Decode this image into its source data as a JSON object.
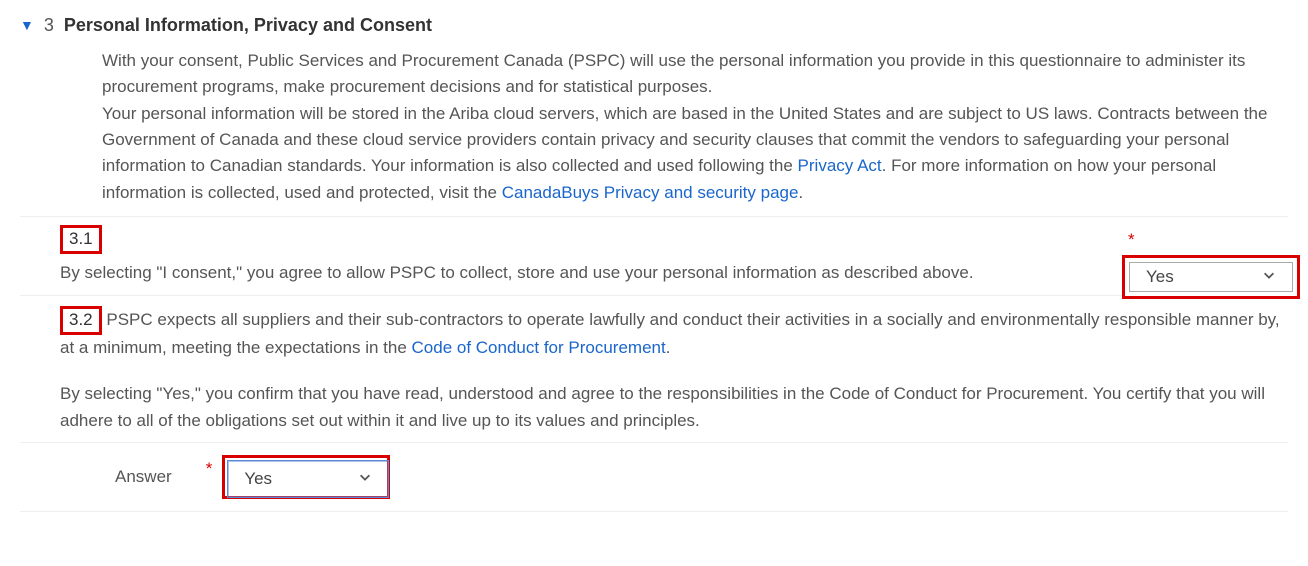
{
  "section": {
    "number": "3",
    "title": "Personal Information, Privacy and Consent",
    "intro_text_1": "With your consent, Public Services and Procurement Canada (PSPC) will use the personal information you provide in this questionnaire to administer its procurement programs, make procurement decisions and for statistical purposes.",
    "intro_text_2a": "Your personal information will be stored in the Ariba cloud servers, which are based in the United States and are subject to US laws. Contracts between the Government of Canada and these cloud service providers contain privacy and security clauses that commit the vendors to safeguarding your personal information to Canadian standards. Your information is also collected and used following the ",
    "link_privacy_act": "Privacy Act",
    "intro_text_2b": ". For more information on how your personal information is collected, used and protected, visit the ",
    "link_canadabuys": "CanadaBuys Privacy and security page",
    "intro_text_2c": "."
  },
  "q31": {
    "number": "3.1",
    "text": "By selecting \"I consent,\" you agree to allow PSPC to collect, store and use your personal information as described above.",
    "required_mark": "*",
    "selected": "Yes"
  },
  "q32": {
    "number": "3.2",
    "text_a": "  PSPC expects all suppliers and their sub-contractors to operate lawfully and conduct their activities in a socially and environmentally responsible manner by, at a minimum, meeting the expectations in the ",
    "link_coc": "Code of Conduct for Procurement",
    "text_b": ".",
    "para2": "By selecting \"Yes,\" you confirm that you have read, understood and agree to the responsibilities in the Code of Conduct for Procurement. You certify that you will adhere to all of the obligations set out within it and live up to its values and principles.",
    "answer_label": "Answer",
    "required_mark": "*",
    "selected": "Yes"
  }
}
